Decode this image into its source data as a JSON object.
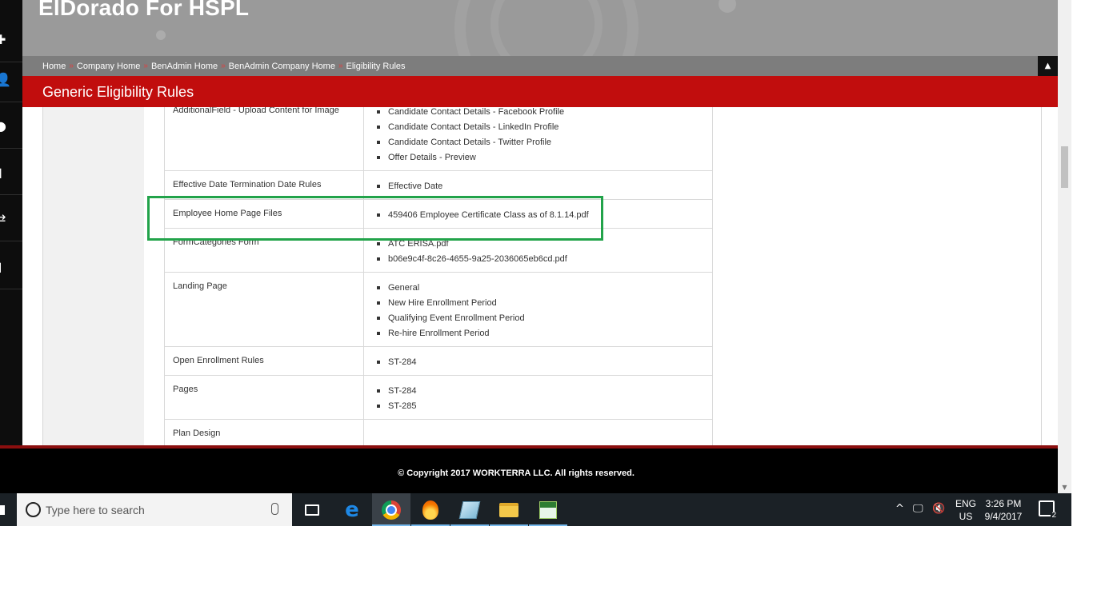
{
  "app": {
    "title": "ElDorado For HSPL"
  },
  "breadcrumb": [
    "Home",
    "Company Home",
    "BenAdmin Home",
    "BenAdmin Company Home",
    "Eligibility Rules"
  ],
  "breadcrumb_separator": "»",
  "page": {
    "title": "Generic Eligibility Rules"
  },
  "rules": {
    "cut_top_label": "AdditionalField - Upload Content for Image",
    "cut_top_values": [
      "Candidate Contact Details - Facebook Profile",
      "Candidate Contact Details - LinkedIn Profile",
      "Candidate Contact Details - Twitter Profile",
      "Offer Details - Preview"
    ],
    "rows": [
      {
        "name": "Effective Date Termination Date Rules",
        "values": [
          "Effective Date"
        ]
      },
      {
        "name": "Employee Home Page Files",
        "values": [
          "459406 Employee Certificate Class as of 8.1.14.pdf"
        ]
      },
      {
        "name": "FormCategories Form",
        "values": [
          "ATC ERISA.pdf",
          "b06e9c4f-8c26-4655-9a25-2036065eb6cd.pdf"
        ]
      },
      {
        "name": "Landing Page",
        "values": [
          "General",
          "New Hire Enrollment Period",
          "Qualifying Event Enrollment Period",
          "Re-hire Enrollment Period"
        ]
      },
      {
        "name": "Open Enrollment Rules",
        "values": [
          "ST-284"
        ]
      },
      {
        "name": "Pages",
        "values": [
          "ST-284",
          "ST-285"
        ]
      }
    ],
    "cut_bottom_label": "Plan Design"
  },
  "highlight": {
    "color": "#22a34a"
  },
  "footer": {
    "copyright": "© Copyright 2017 WORKTERRA LLC. All rights reserved."
  },
  "sidebar_icons": [
    "puzzle-icon",
    "user-star-icon",
    "user-icon",
    "bar-chart-icon",
    "transfer-arrows-icon",
    "chat-bubble-icon"
  ],
  "taskbar": {
    "search_placeholder": "Type here to search",
    "apps": [
      "task-view-icon",
      "edge-icon",
      "chrome-icon",
      "flame-app-icon",
      "notepad-app-icon",
      "file-explorer-icon",
      "spreadsheet-app-icon"
    ],
    "lang_line1": "ENG",
    "lang_line2": "US",
    "time": "3:26 PM",
    "date": "9/4/2017",
    "notifications": "2"
  },
  "colors": {
    "brand_red": "#c10d0d",
    "header_gray": "#9a9a9a",
    "breadcrumb_gray": "#7d7d7d"
  }
}
